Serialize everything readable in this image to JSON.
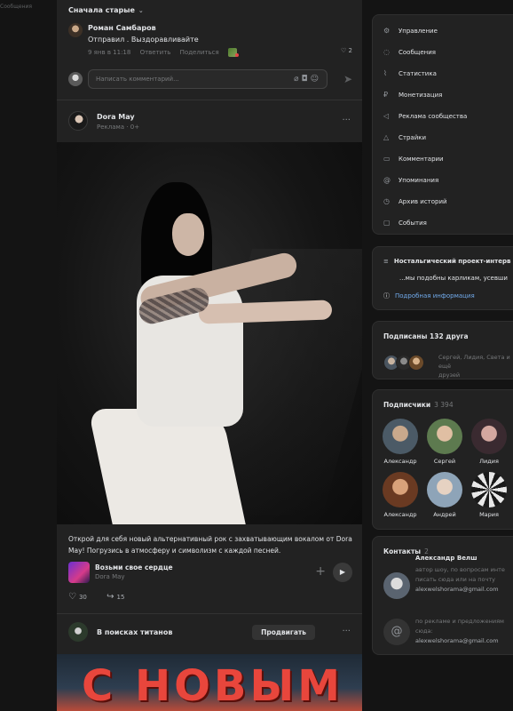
{
  "left": {
    "tag": "Сообщения"
  },
  "feed": {
    "sort_label": "Сначала старые",
    "comment": {
      "author": "Роман Самбаров",
      "text": "Отправил . Выздоравливайте",
      "time": "9 янв в 11:18",
      "reply": "Ответить",
      "share": "Поделиться",
      "likes": "2"
    },
    "comment_placeholder": "Написать комментарий...",
    "post": {
      "author": "Dora May",
      "sub": "Реклама · 0+",
      "text": "Открой для себя новый альтернативный рок с захватывающим вокалом от Dora May! Погрузись в атмосферу и символизм с каждой песней.",
      "track_title": "Возьми свое сердце",
      "track_artist": "Dora May",
      "likes": "30",
      "shares": "15"
    },
    "ad": {
      "name": "В поисках титанов",
      "promote": "Продвигать"
    },
    "banner_text": "С НОВЫМ"
  },
  "menu": {
    "items": [
      {
        "label": "Управление",
        "icon": "gear-icon"
      },
      {
        "label": "Сообщения",
        "icon": "message-icon"
      },
      {
        "label": "Статистика",
        "icon": "stats-icon"
      },
      {
        "label": "Монетизация",
        "icon": "ruble-icon"
      },
      {
        "label": "Реклама сообщества",
        "icon": "megaphone-icon"
      },
      {
        "label": "Страйки",
        "icon": "warning-icon"
      },
      {
        "label": "Комментарии",
        "icon": "comment-icon"
      },
      {
        "label": "Упоминания",
        "icon": "at-icon"
      },
      {
        "label": "Архив историй",
        "icon": "history-icon"
      },
      {
        "label": "События",
        "icon": "events-icon"
      }
    ]
  },
  "nostalgic": {
    "title": "Ностальгический проект-интерв",
    "text": "...мы подобны карликам, усевши",
    "link": "Подробная информация"
  },
  "friends": {
    "title": "Подписаны 132 друга",
    "names": "Сергей, Лидия, Света и ещё",
    "names2": "друзей"
  },
  "subscribers": {
    "title": "Подписчики",
    "count": "3 394",
    "people": [
      {
        "name": "Александр"
      },
      {
        "name": "Сергей"
      },
      {
        "name": "Лидия"
      },
      {
        "name": "Александр"
      },
      {
        "name": "Андрей"
      },
      {
        "name": "Мария"
      }
    ]
  },
  "contacts": {
    "title": "Контакты",
    "count": "2",
    "person": {
      "name": "Александр Велш",
      "desc1": "автор шоу, по вопросам инте",
      "desc2": "писать сюда или на почту",
      "email": "alexwelshorama@gmail.com"
    },
    "other": {
      "desc1": "по рекламе и предложениям",
      "desc2": "сюда:",
      "email": "alexwelshorama@gmail.com"
    }
  }
}
